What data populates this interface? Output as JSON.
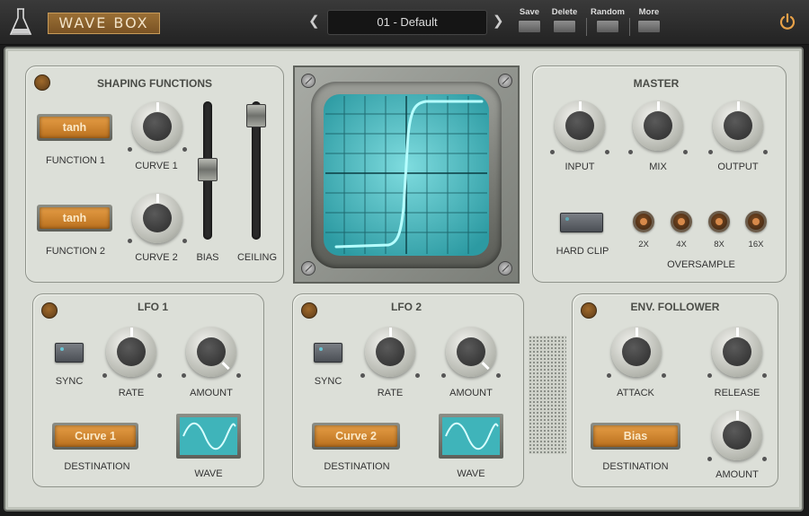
{
  "app": {
    "logo_text": "WAVE BOX",
    "brand_icon": "flask-icon"
  },
  "toolbar": {
    "preset_name": "01 - Default",
    "save_label": "Save",
    "delete_label": "Delete",
    "random_label": "Random",
    "more_label": "More"
  },
  "shaping": {
    "title": "SHAPING FUNCTIONS",
    "function1_value": "tanh",
    "function1_label": "FUNCTION 1",
    "function2_value": "tanh",
    "function2_label": "FUNCTION 2",
    "curve1_label": "CURVE 1",
    "curve2_label": "CURVE 2",
    "bias_label": "BIAS",
    "ceiling_label": "CEILING"
  },
  "master": {
    "title": "MASTER",
    "input_label": "INPUT",
    "mix_label": "MIX",
    "output_label": "OUTPUT",
    "hardclip_label": "HARD CLIP",
    "oversample_label": "OVERSAMPLE",
    "oversample_options": [
      "2X",
      "4X",
      "8X",
      "16X"
    ]
  },
  "lfo1": {
    "title": "LFO 1",
    "sync_label": "SYNC",
    "rate_label": "RATE",
    "amount_label": "AMOUNT",
    "destination_value": "Curve 1",
    "destination_label": "DESTINATION",
    "wave_label": "WAVE"
  },
  "lfo2": {
    "title": "LFO 2",
    "sync_label": "SYNC",
    "rate_label": "RATE",
    "amount_label": "AMOUNT",
    "destination_value": "Curve 2",
    "destination_label": "DESTINATION",
    "wave_label": "WAVE"
  },
  "env": {
    "title": "ENV. FOLLOWER",
    "attack_label": "ATTACK",
    "release_label": "RELEASE",
    "destination_value": "Bias",
    "destination_label": "DESTINATION",
    "amount_label": "AMOUNT"
  },
  "colors": {
    "accent": "#e8a148",
    "scope_trace": "#7ff0f0",
    "scope_bg": "#4fbfc5"
  }
}
